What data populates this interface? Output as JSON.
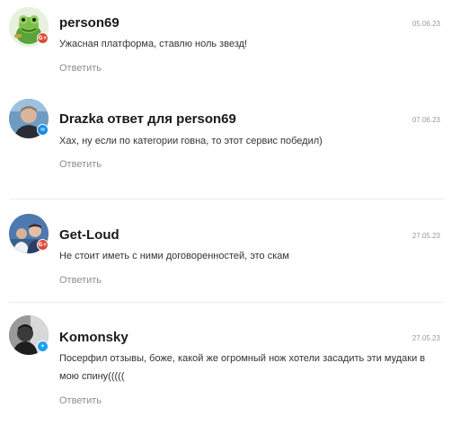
{
  "comments": [
    {
      "author": "person69",
      "date": "05.06.23",
      "text": "Ужасная платформа, ставлю ноль звезд!",
      "reply_label": "Ответить",
      "badge": "G+",
      "badge_color": "#dd4b39"
    },
    {
      "author": "Drazka ответ для person69",
      "date": "07.06.23",
      "text": "Хах, ну если по категории говна, то этот сервис победил)",
      "reply_label": "Ответить",
      "badge": "mail",
      "badge_color": "#168de2"
    },
    {
      "author": "Get-Loud",
      "date": "27.05.23",
      "text": "Не стоит иметь с ними договоренностей, это скам",
      "reply_label": "Ответить",
      "badge": "G+",
      "badge_color": "#dd4b39"
    },
    {
      "author": "Komonsky",
      "date": "27.05.23",
      "text": "Посерфил отзывы, боже, какой же огромный нож хотели засадить эти мудаки в мою спину(((((",
      "reply_label": "Ответить",
      "badge": "twitter",
      "badge_color": "#1da1f2"
    }
  ]
}
